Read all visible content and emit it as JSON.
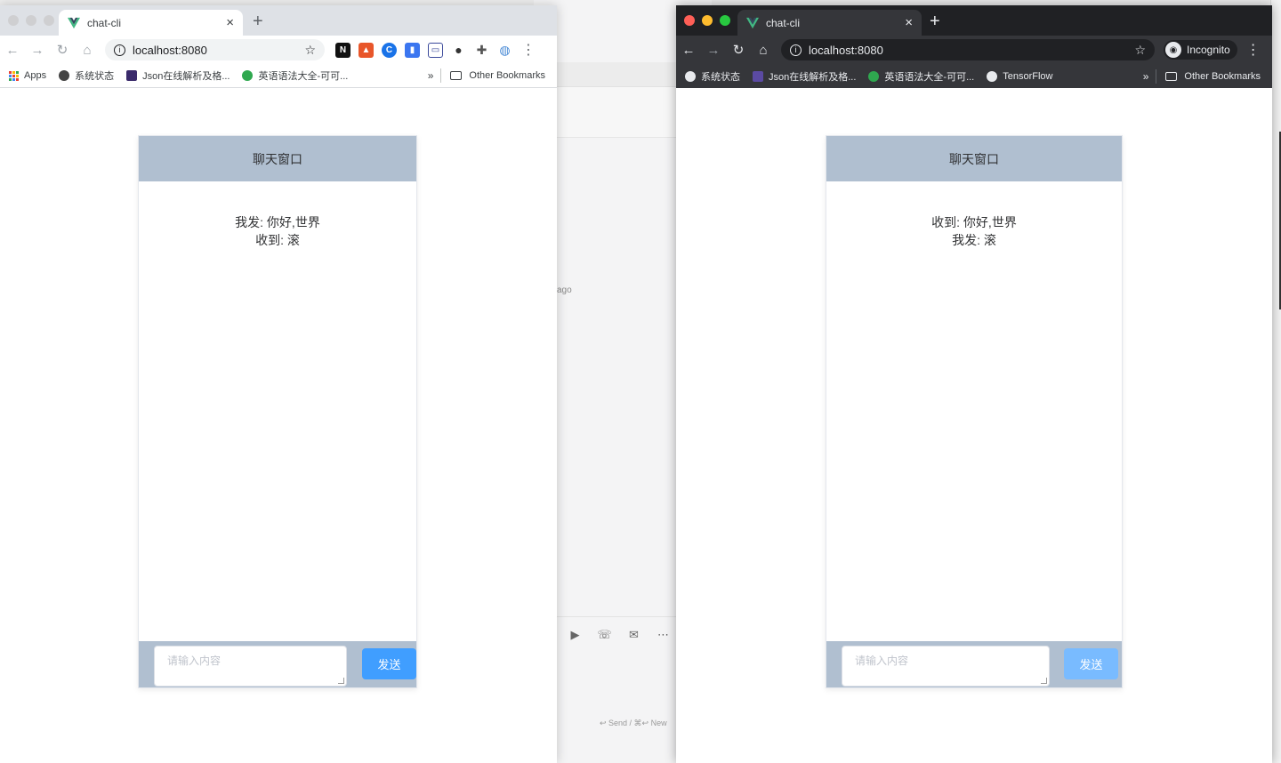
{
  "background_app": {
    "ago_text": "ago",
    "send_hint": "↩ Send / ⌘↩ New"
  },
  "left_browser": {
    "tab_title": "chat-cli",
    "url": "localhost:8080",
    "bookmarks": [
      "Apps",
      "系统状态",
      "Json在线解析及格...",
      "英语语法大全-可可..."
    ],
    "more": "»",
    "other_bookmarks": "Other Bookmarks",
    "chat": {
      "header": "聊天窗口",
      "messages": [
        "我发: 你好,世界",
        "收到: 滚"
      ],
      "input_placeholder": "请输入内容",
      "send_label": "发送"
    }
  },
  "right_browser": {
    "tab_title": "chat-cli",
    "url": "localhost:8080",
    "incognito_label": "Incognito",
    "bookmarks": [
      "系统状态",
      "Json在线解析及格...",
      "英语语法大全-可可...",
      "TensorFlow"
    ],
    "more": "»",
    "other_bookmarks": "Other Bookmarks",
    "chat": {
      "header": "聊天窗口",
      "messages": [
        "收到: 你好,世界",
        "我发: 滚"
      ],
      "input_placeholder": "请输入内容",
      "send_label": "发送"
    }
  },
  "colors": {
    "chat_header_bg": "#b0bfd0",
    "send_primary": "#409eff",
    "send_light": "#79bbff",
    "vue_green": "#42b883"
  }
}
